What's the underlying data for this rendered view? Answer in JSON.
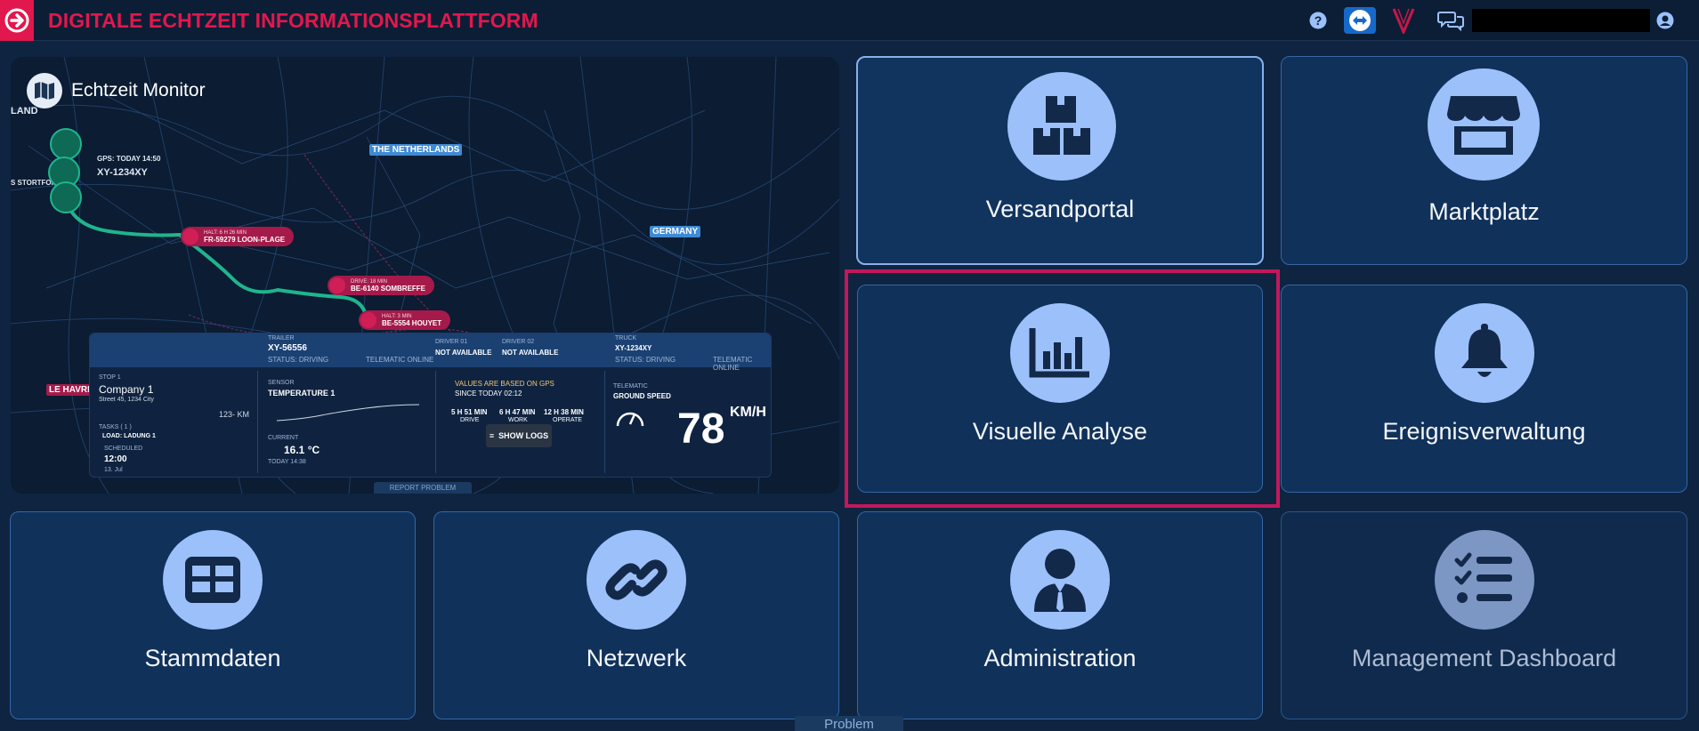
{
  "header": {
    "title": "DIGITALE ECHTZEIT INFORMATIONSPLATTFORM",
    "icons": [
      "help-icon",
      "teamviewer-icon",
      "v-logo-icon",
      "chat-icon",
      "user-icon"
    ]
  },
  "map": {
    "title": "Echtzeit Monitor",
    "labels": {
      "land": "LAND",
      "netherlands": "THE NETHERLANDS",
      "germany": "GERMANY",
      "le_havre": "LE HAVRE",
      "stortford": "S STORTFORD"
    },
    "vehicle": {
      "gps": "GPS: TODAY 14:50",
      "plate": "XY-1234XY"
    },
    "pins": [
      {
        "small": "HALT: 6 H 26 MIN",
        "large": "FR-59279 LOON-PLAGE"
      },
      {
        "small": "DRIVE: 18 MIN",
        "large": "BE-6140 SOMBREFFE"
      },
      {
        "small": "HALT: 3 MIN",
        "large": "BE-5554 HOUYET"
      }
    ],
    "panel": {
      "trailer_label": "TRAILER",
      "trailer_value": "XY-56556",
      "trailer_status": "STATUS: DRIVING",
      "telematic_online": "TELEMATIC ONLINE",
      "driver1_label": "DRIVER 01",
      "driver1_value": "NOT AVAILABLE",
      "driver2_label": "DRIVER 02",
      "driver2_value": "NOT AVAILABLE",
      "truck_label": "TRUCK",
      "truck_value": "XY-1234XY",
      "truck_status": "STATUS: DRIVING",
      "truck_telematic": "TELEMATIC ONLINE",
      "stop_label": "STOP 1",
      "company": "Company 1",
      "address": "Street 45, 1234 City",
      "distance": "123- KM",
      "tasks_label": "TASKS ( 1 )",
      "task": "LOAD: LADUNG 1",
      "scheduled_label": "SCHEDULED",
      "scheduled_time": "12:00",
      "scheduled_date": "13. Jul",
      "sensor_label": "SENSOR",
      "sensor_value": "TEMPERATURE 1",
      "current_label": "CURRENT",
      "current_temp": "16.1 °C",
      "current_time": "TODAY 14:38",
      "gps_note": "VALUES ARE BASED ON GPS",
      "since": "SINCE TODAY 02:12",
      "drive_time": "5 H 51 MIN",
      "drive_label": "DRIVE",
      "work_time": "6 H 47 MIN",
      "work_label": "WORK",
      "operate_time": "12 H 38 MIN",
      "operate_label": "OPERATE",
      "show_logs": "SHOW LOGS",
      "telematic_label": "TELEMATIC",
      "ground_speed": "GROUND SPEED",
      "speed": "78",
      "speed_unit": "KM/H"
    },
    "report_problem": "REPORT PROBLEM"
  },
  "tiles": [
    {
      "label": "Versandportal",
      "icon": "boxes-icon"
    },
    {
      "label": "Marktplatz",
      "icon": "store-icon"
    },
    {
      "label": "Visuelle Analyse",
      "icon": "chart-icon"
    },
    {
      "label": "Ereignisverwaltung",
      "icon": "bell-icon"
    },
    {
      "label": "Stammdaten",
      "icon": "table-icon"
    },
    {
      "label": "Netzwerk",
      "icon": "link-icon"
    },
    {
      "label": "Administration",
      "icon": "admin-icon"
    },
    {
      "label": "Management Dashboard",
      "icon": "checklist-icon"
    }
  ],
  "problem_tab": "Problem",
  "colors": {
    "brand": "#e2174d",
    "tile_bg": "#10315a",
    "icon_circle": "#9cc0fa",
    "highlight": "#c2185b"
  }
}
